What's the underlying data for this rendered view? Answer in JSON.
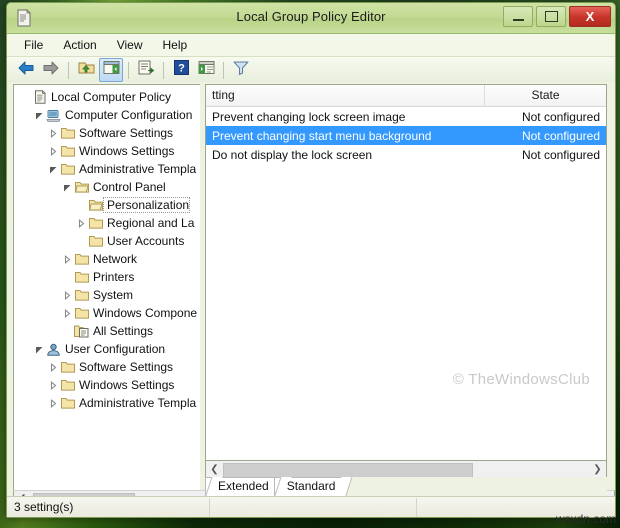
{
  "window": {
    "title": "Local Group Policy Editor",
    "icon": "policy-document-icon",
    "buttons": {
      "minimize": "minimize-icon",
      "maximize": "maximize-icon",
      "close": "X"
    }
  },
  "menu": {
    "items": [
      {
        "label": "File"
      },
      {
        "label": "Action"
      },
      {
        "label": "View"
      },
      {
        "label": "Help"
      }
    ]
  },
  "toolbar": {
    "items": [
      {
        "name": "back-arrow-icon",
        "title": "Back"
      },
      {
        "name": "forward-arrow-icon",
        "title": "Forward"
      },
      {
        "name": "up-one-level-icon",
        "title": "Up one level"
      },
      {
        "name": "show-hide-console-tree-icon",
        "title": "Show/Hide Console Tree",
        "active": true
      },
      {
        "name": "export-list-icon",
        "title": "Export List"
      },
      {
        "name": "help-icon",
        "title": "Help"
      },
      {
        "name": "show-properties-icon",
        "title": "Properties"
      },
      {
        "name": "filter-icon",
        "title": "Filter"
      }
    ]
  },
  "tree": {
    "nodes": [
      {
        "label": "Local Computer Policy",
        "indent": 0,
        "twist": "none",
        "icon": "policy-document-icon"
      },
      {
        "label": "Computer Configuration",
        "indent": 1,
        "twist": "expanded",
        "icon": "computer-icon"
      },
      {
        "label": "Software Settings",
        "indent": 2,
        "twist": "collapsed",
        "icon": "folder-icon"
      },
      {
        "label": "Windows Settings",
        "indent": 2,
        "twist": "collapsed",
        "icon": "folder-icon"
      },
      {
        "label": "Administrative Templa",
        "indent": 2,
        "twist": "expanded",
        "icon": "folder-icon"
      },
      {
        "label": "Control Panel",
        "indent": 3,
        "twist": "expanded",
        "icon": "folder-open-icon"
      },
      {
        "label": "Personalization",
        "indent": 4,
        "twist": "none",
        "icon": "folder-open-icon",
        "selected": true
      },
      {
        "label": "Regional and La",
        "indent": 4,
        "twist": "collapsed",
        "icon": "folder-icon"
      },
      {
        "label": "User Accounts",
        "indent": 4,
        "twist": "none",
        "icon": "folder-icon"
      },
      {
        "label": "Network",
        "indent": 3,
        "twist": "collapsed",
        "icon": "folder-icon"
      },
      {
        "label": "Printers",
        "indent": 3,
        "twist": "none",
        "icon": "folder-icon"
      },
      {
        "label": "System",
        "indent": 3,
        "twist": "collapsed",
        "icon": "folder-icon"
      },
      {
        "label": "Windows Compone",
        "indent": 3,
        "twist": "collapsed",
        "icon": "folder-icon"
      },
      {
        "label": "All Settings",
        "indent": 3,
        "twist": "none",
        "icon": "all-settings-icon"
      },
      {
        "label": "User Configuration",
        "indent": 1,
        "twist": "expanded",
        "icon": "user-icon"
      },
      {
        "label": "Software Settings",
        "indent": 2,
        "twist": "collapsed",
        "icon": "folder-icon"
      },
      {
        "label": "Windows Settings",
        "indent": 2,
        "twist": "collapsed",
        "icon": "folder-icon"
      },
      {
        "label": "Administrative Templa",
        "indent": 2,
        "twist": "collapsed",
        "icon": "folder-icon"
      }
    ]
  },
  "list": {
    "columns": [
      {
        "label": "tting"
      },
      {
        "label": "State"
      }
    ],
    "rows": [
      {
        "setting": "Prevent changing lock screen image",
        "state": "Not configured",
        "selected": false
      },
      {
        "setting": "Prevent changing start menu background",
        "state": "Not configured",
        "selected": true
      },
      {
        "setting": "Do not display the lock screen",
        "state": "Not configured",
        "selected": false
      }
    ],
    "watermark": "© TheWindowsClub"
  },
  "tabs": [
    {
      "label": "Extended",
      "active": false
    },
    {
      "label": "Standard",
      "active": true
    }
  ],
  "statusbar": {
    "text": "3 setting(s)"
  },
  "overlay": {
    "site": "wsxdn.com"
  },
  "colors": {
    "titlebar": "#c3da93",
    "selection": "#3399ff",
    "close_button": "#c8352a",
    "window_frame": "#7d9b52"
  }
}
